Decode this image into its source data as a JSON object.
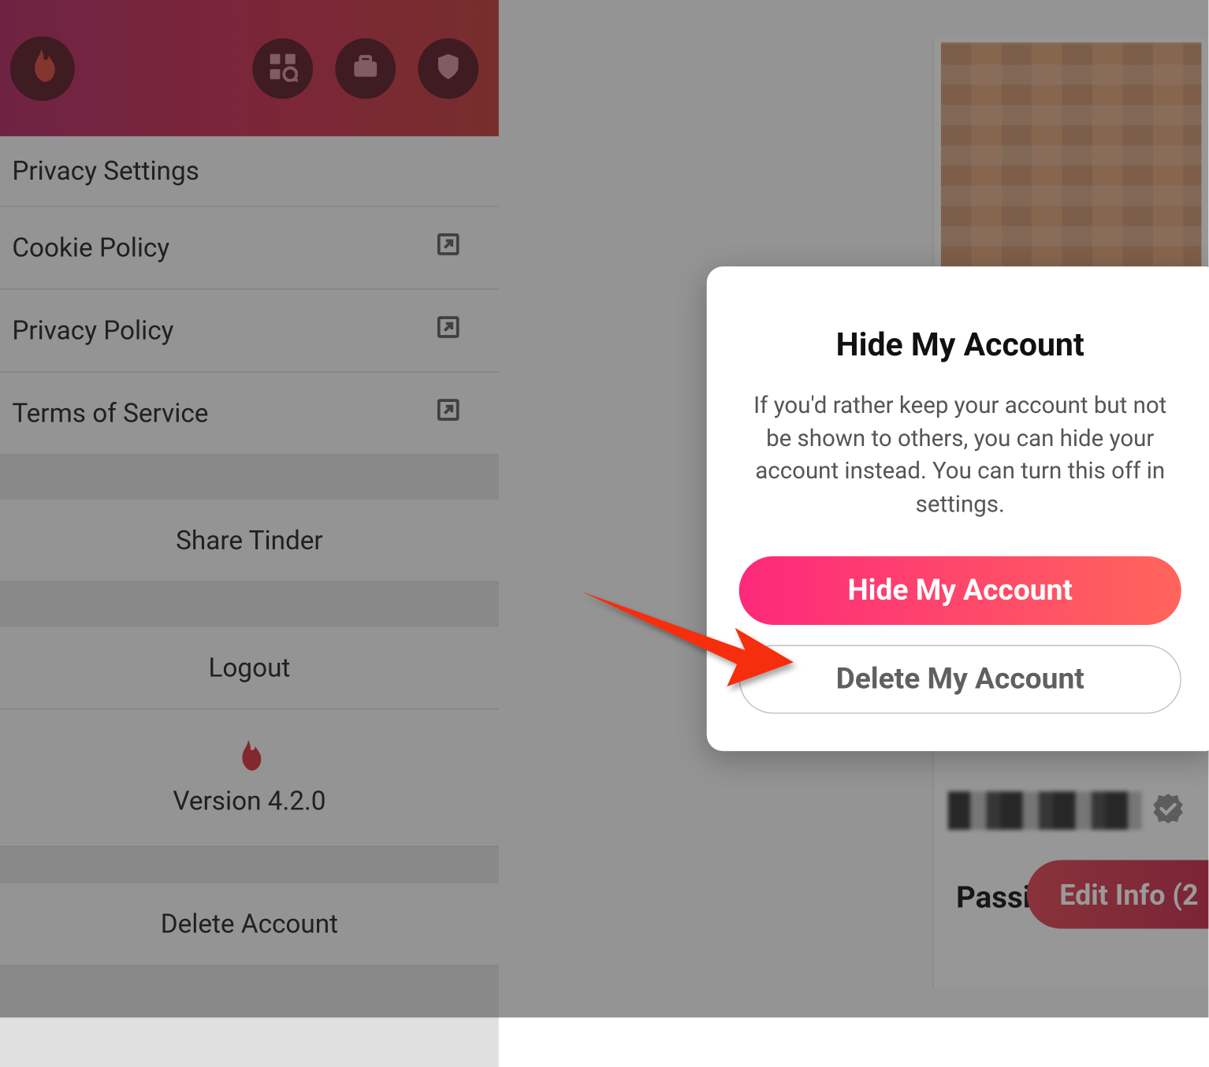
{
  "sidebar": {
    "items": [
      {
        "label": "Privacy Settings",
        "external": false
      },
      {
        "label": "Cookie Policy",
        "external": true
      },
      {
        "label": "Privacy Policy",
        "external": true
      },
      {
        "label": "Terms of Service",
        "external": true
      }
    ],
    "share_label": "Share Tinder",
    "logout_label": "Logout",
    "version_label": "Version 4.2.0",
    "delete_label": "Delete Account"
  },
  "profile": {
    "passions_label": "Passions",
    "edit_info_label": "Edit Info (2"
  },
  "modal": {
    "title": "Hide My Account",
    "body": "If you'd rather keep your account but not be shown to others, you can hide your account instead. You can turn this off in settings.",
    "hide_label": "Hide My Account",
    "delete_label": "Delete My Account"
  }
}
